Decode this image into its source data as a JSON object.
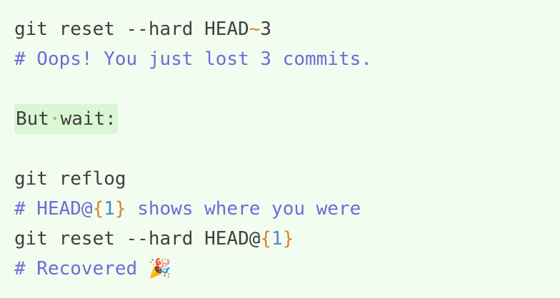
{
  "lines": {
    "l1": {
      "cmd": "git reset --hard HEAD",
      "tilde": "~",
      "num": "3"
    },
    "l2": {
      "comment": "# Oops! You just lost 3 commits."
    },
    "l4": {
      "w1": "But",
      "dot": "·",
      "w2": "wait:"
    },
    "l6": {
      "cmd": "git reflog"
    },
    "l7": {
      "prefix": "# HEAD@",
      "open": "{",
      "num": "1",
      "close": "}",
      "rest": " shows where you were"
    },
    "l8": {
      "cmd": "git reset --hard HEAD@",
      "open": "{",
      "num": "1",
      "close": "}"
    },
    "l9": {
      "comment": "# Recovered ",
      "emoji": "🎉"
    }
  },
  "colors": {
    "background": "#f2fdf0",
    "text": "#3f3f3f",
    "comment": "#6f6ad6",
    "operator": "#d7832f",
    "number": "#4f86c6",
    "highlight": "#d9f7d3"
  }
}
